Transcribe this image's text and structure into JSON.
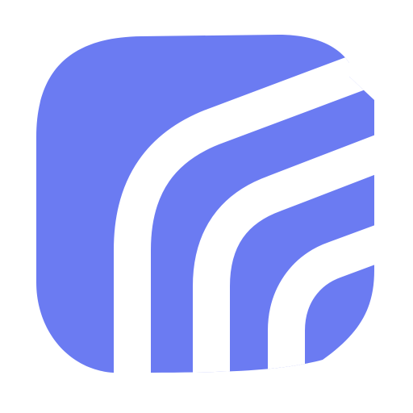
{
  "logo": {
    "icon_name": "app-logo-icon",
    "shape": "rounded-square",
    "motif": "concentric-stripes",
    "colors": {
      "background": "#ffffff",
      "fill": "#6b7bf2",
      "stripe": "#ffffff"
    }
  }
}
